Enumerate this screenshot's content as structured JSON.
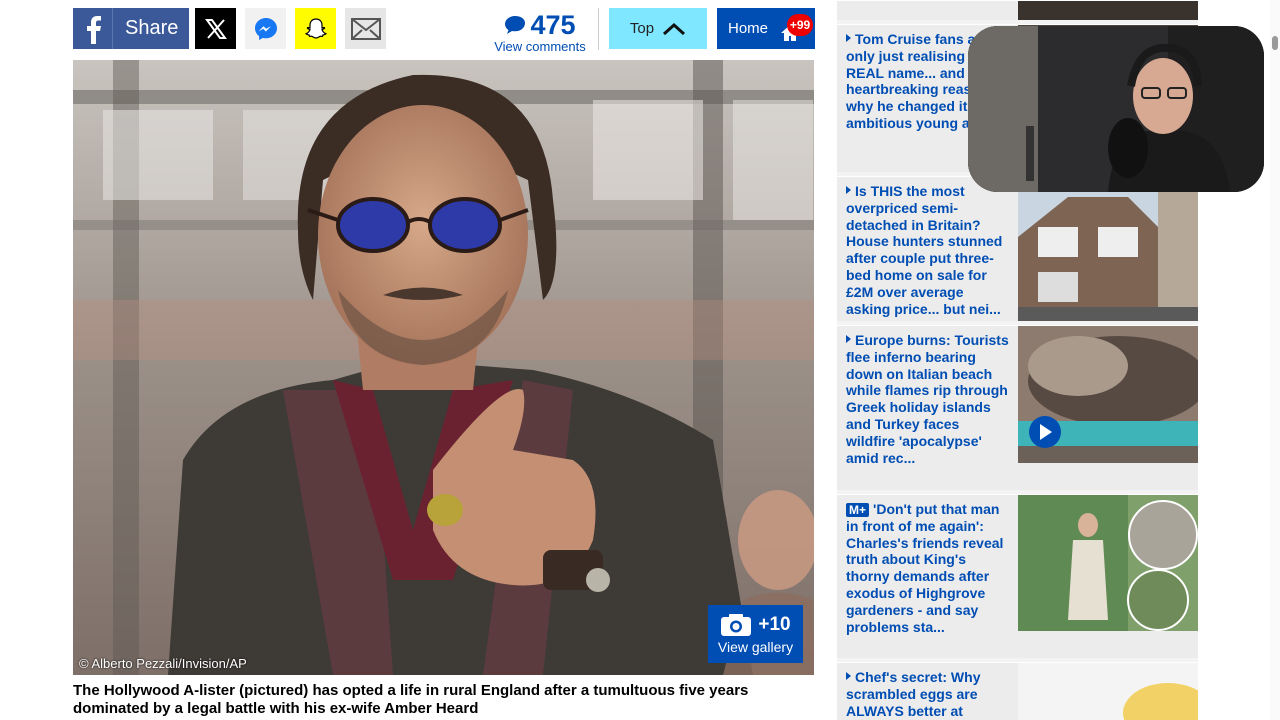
{
  "share_bar": {
    "facebook_label": "Share",
    "facebook_icon": "facebook-icon",
    "x_icon": "x-icon",
    "messenger_icon": "messenger-icon",
    "snapchat_icon": "snapchat-icon",
    "email_icon": "email-icon"
  },
  "comments": {
    "count": "475",
    "label": "View comments"
  },
  "nav": {
    "top_label": "Top",
    "home_label": "Home",
    "home_badge": "+99"
  },
  "article": {
    "photo_credit": "© Alberto Pezzali/Invision/AP",
    "gallery_count": "+10",
    "gallery_label": "View gallery",
    "caption": "The Hollywood A-lister (pictured) has opted a life in rural England after a tumultuous five years dominated by a legal battle with his ex-wife Amber Heard"
  },
  "sidebar": {
    "stories": [
      {
        "prefix": "",
        "text": "Tom Cruise fans are only just realising his REAL name... and heartbreaking reason why he changed it as an ambitious young actor"
      },
      {
        "prefix": "",
        "text": "Is THIS the most overpriced semi-detached in Britain? House hunters stunned after couple put three-bed home on sale for £2M over average asking price... but nei..."
      },
      {
        "prefix": "",
        "text": "Europe burns: Tourists flee inferno bearing down on Italian beach while flames rip through Greek holiday islands and Turkey faces wildfire 'apocalypse' amid rec..."
      },
      {
        "prefix": "M+",
        "text": "'Don't put that man in front of me again': Charles's friends reveal truth about King's thorny demands after exodus of Highgrove gardeners - and say problems sta..."
      },
      {
        "prefix": "",
        "text": "Chef's secret: Why scrambled eggs are ALWAYS better at"
      }
    ]
  },
  "colors": {
    "brand_blue": "#004db3",
    "facebook_blue": "#3b5998",
    "top_button": "#7fe7ff",
    "badge_red": "#e00000"
  }
}
